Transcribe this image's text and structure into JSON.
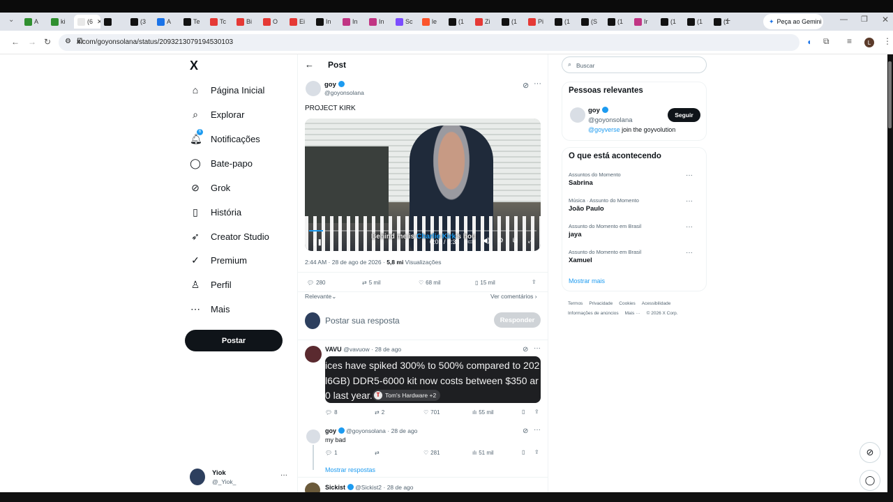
{
  "browser": {
    "tabs": [
      {
        "label": "A",
        "color": "#2f8f2f"
      },
      {
        "label": "ki",
        "color": "#2f8f2f"
      },
      {
        "label": "(6",
        "color": "#e8e8e8",
        "active": true
      },
      {
        "label": "",
        "color": "#111"
      },
      {
        "label": "(3",
        "color": "#111"
      },
      {
        "label": "A",
        "color": "#1a73e8"
      },
      {
        "label": "Te",
        "color": "#111"
      },
      {
        "label": "Tc",
        "color": "#e53935"
      },
      {
        "label": "Bi",
        "color": "#e53935"
      },
      {
        "label": "O",
        "color": "#e53935"
      },
      {
        "label": "Ei",
        "color": "#e53935"
      },
      {
        "label": "In",
        "color": "#111"
      },
      {
        "label": "In",
        "color": "#c13584"
      },
      {
        "label": "In",
        "color": "#c13584"
      },
      {
        "label": "Sc",
        "color": "#7c4dff"
      },
      {
        "label": "le",
        "color": "#fb542b"
      },
      {
        "label": "(1",
        "color": "#111"
      },
      {
        "label": "Zi",
        "color": "#e53935"
      },
      {
        "label": "(1",
        "color": "#111"
      },
      {
        "label": "Pi",
        "color": "#e53935"
      },
      {
        "label": "(1",
        "color": "#111"
      },
      {
        "label": "(S",
        "color": "#111"
      },
      {
        "label": "(1",
        "color": "#111"
      },
      {
        "label": "Ir",
        "color": "#c13584"
      },
      {
        "label": "(1",
        "color": "#111"
      },
      {
        "label": "(1",
        "color": "#111"
      },
      {
        "label": "(1",
        "color": "#111"
      }
    ],
    "gemini_label": "Peça ao Gemini",
    "url": "x.com/goyonsolana/status/2093213079194530103",
    "profile_initial": "L"
  },
  "nav": {
    "logo": "X",
    "items": [
      {
        "label": "Página Inicial",
        "icon": "home-icon",
        "glyph": "⌂"
      },
      {
        "label": "Explorar",
        "icon": "search-icon",
        "glyph": "⌕"
      },
      {
        "label": "Notificações",
        "icon": "bell-icon",
        "glyph": "🔔︎",
        "badge": "6"
      },
      {
        "label": "Bate-papo",
        "icon": "chat-icon",
        "glyph": "◯"
      },
      {
        "label": "Grok",
        "icon": "grok-icon",
        "glyph": "⊘"
      },
      {
        "label": "História",
        "icon": "bookmark-icon",
        "glyph": "▯"
      },
      {
        "label": "Creator Studio",
        "icon": "rocket-icon",
        "glyph": "➶"
      },
      {
        "label": "Premium",
        "icon": "premium-icon",
        "glyph": "✓"
      },
      {
        "label": "Perfil",
        "icon": "person-icon",
        "glyph": "♙"
      },
      {
        "label": "Mais",
        "icon": "more-circle-icon",
        "glyph": "⋯"
      }
    ],
    "post_button": "Postar",
    "account": {
      "name": "Yiok",
      "handle": "@_Yiok_",
      "more": "···"
    }
  },
  "post": {
    "header_title": "Post",
    "author": "goy",
    "handle": "@goyonsolana",
    "text": "PROJECT KIRK",
    "video": {
      "subtitle_before": "Behind me is ",
      "subtitle_highlight": "Charlie Kirk",
      "subtitle_after": "'s hou",
      "time": "0:02 / 0:33",
      "progress": 0.06
    },
    "timestamp": "2:44 AM · 28 de ago de 2026 · ",
    "views_count": "5,8 mi",
    "views_label": " Visualizações",
    "stats": {
      "replies": "280",
      "reposts": "5 mil",
      "likes": "68 mil",
      "bookmarks": "15 mil"
    },
    "sort_label": "Relevante",
    "view_quotes": "Ver comentários",
    "reply_placeholder": "Postar sua resposta",
    "reply_button": "Responder"
  },
  "replies": [
    {
      "author": "VAVU",
      "handle": "@vavuow",
      "date": "· 28 de ago",
      "image_lines": [
        "ices have spiked 300% to 500% compared to 202",
        "l6GB) DDR5-6000 kit now costs between $350 ar",
        "0 last year."
      ],
      "image_source": "Tom's Hardware +2",
      "stats": {
        "replies": "8",
        "reposts": "2",
        "likes": "701",
        "views": "55 mil"
      }
    },
    {
      "author": "goy",
      "handle": "@goyonsolana",
      "date": "· 28 de ago",
      "text": "my bad",
      "stats": {
        "replies": "1",
        "reposts": "",
        "likes": "281",
        "views": "51 mil"
      },
      "show_replies": "Mostrar respostas"
    },
    {
      "author": "Sickist",
      "handle": "@Sickist2",
      "date": "· 28 de ago"
    }
  ],
  "sidebar": {
    "search_placeholder": "Buscar",
    "relevant_title": "Pessoas relevantes",
    "person": {
      "name": "goy",
      "handle": "@goyonsolana",
      "bio_link": "@goyverse",
      "bio_rest": " join the goyvolution",
      "follow": "Seguir"
    },
    "trends_title": "O que está acontecendo",
    "trends": [
      {
        "category": "Assuntos do Momento",
        "name": "Sabrina"
      },
      {
        "category": "Música · Assunto do Momento",
        "name": "João Paulo"
      },
      {
        "category": "Assunto do Momento em Brasil",
        "name": "jaya"
      },
      {
        "category": "Assunto do Momento em Brasil",
        "name": "Xamuel"
      }
    ],
    "show_more": "Mostrar mais",
    "footer_line1": [
      "Termos",
      "Privacidade",
      "Cookies",
      "Acessibilidade"
    ],
    "footer_line2": [
      "Informações de anúncios",
      "Mais ···",
      "© 2026 X Corp."
    ]
  },
  "colors": {
    "accent": "#1d9bf0",
    "dark": "#0f1419",
    "muted": "#536471"
  }
}
